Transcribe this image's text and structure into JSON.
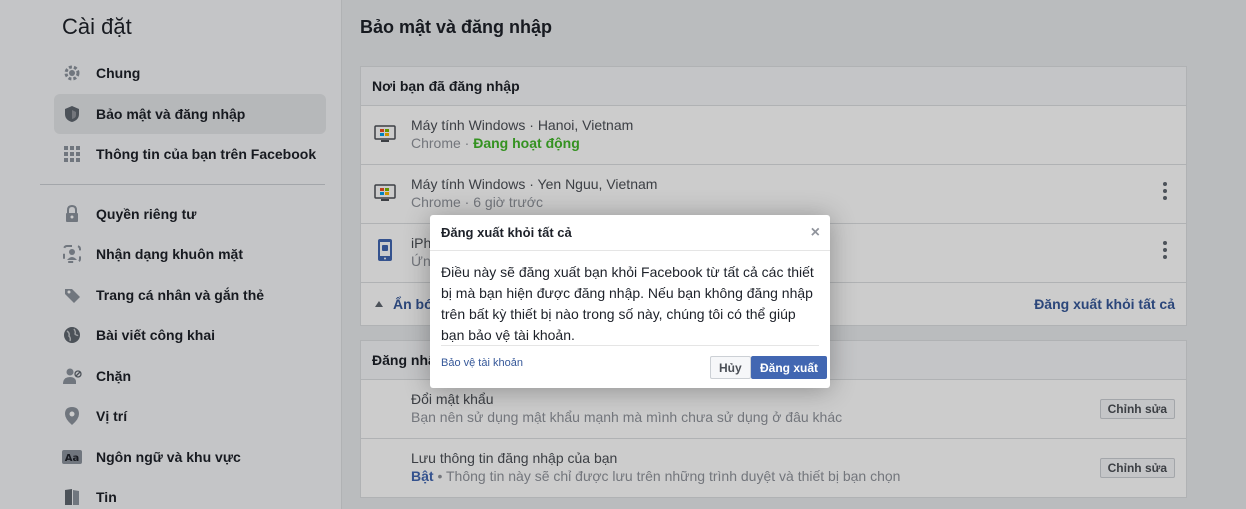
{
  "sidebar": {
    "title": "Cài đặt",
    "items": [
      {
        "label": "Chung",
        "icon": "gear-icon"
      },
      {
        "label": "Bảo mật và đăng nhập",
        "icon": "shield-icon"
      },
      {
        "label": "Thông tin của bạn trên Facebook",
        "icon": "grid-icon"
      },
      {
        "label": "Quyền riêng tư",
        "icon": "lock-icon"
      },
      {
        "label": "Nhận dạng khuôn mặt",
        "icon": "face-icon"
      },
      {
        "label": "Trang cá nhân và gắn thẻ",
        "icon": "tag-icon"
      },
      {
        "label": "Bài viết công khai",
        "icon": "globe-icon"
      },
      {
        "label": "Chặn",
        "icon": "block-user-icon"
      },
      {
        "label": "Vị trí",
        "icon": "location-icon"
      },
      {
        "label": "Ngôn ngữ và khu vực",
        "icon": "language-icon"
      },
      {
        "label": "Tin",
        "icon": "story-icon"
      }
    ]
  },
  "main": {
    "title": "Bảo mật và đăng nhập",
    "where_logged_in": {
      "header": "Nơi bạn đã đăng nhập",
      "sessions": [
        {
          "device": "Máy tính Windows · Hanoi, Vietnam",
          "browser": "Chrome · ",
          "status": "Đang hoạt động",
          "icon": "windows-desktop-icon"
        },
        {
          "device": "Máy tính Windows · Yen Nguu, Vietnam",
          "browser": "Chrome · 6 giờ trước",
          "icon": "windows-desktop-icon"
        },
        {
          "device": "iPh",
          "browser": "Ứn",
          "icon": "iphone-icon"
        }
      ],
      "hide_label": "Ẩn bớ",
      "logout_all_label": "Đăng xuất khỏi tất cả"
    },
    "login": {
      "header": "Đăng nhậ",
      "rows": [
        {
          "title": "Đổi mật khẩu",
          "desc": "Bạn nên sử dụng mật khẩu mạnh mà mình chưa sử dụng ở đâu khác",
          "button": "Chỉnh sửa"
        },
        {
          "title": "Lưu thông tin đăng nhập của bạn",
          "on_label": "Bật",
          "desc": " • Thông tin này sẽ chỉ được lưu trên những trình duyệt và thiết bị bạn chọn",
          "button": "Chỉnh sửa"
        }
      ]
    }
  },
  "dialog": {
    "title": "Đăng xuất khỏi tất cả",
    "close": "×",
    "body": "Điều này sẽ đăng xuất bạn khỏi Facebook từ tất cả các thiết bị mà bạn hiện được đăng nhập. Nếu bạn không đăng nhập trên bất kỳ thiết bị nào trong số này, chúng tôi có thể giúp bạn bảo vệ tài khoản.",
    "protect_link": "Bảo vệ tài khoản",
    "cancel": "Hủy",
    "logout": "Đăng xuất"
  }
}
